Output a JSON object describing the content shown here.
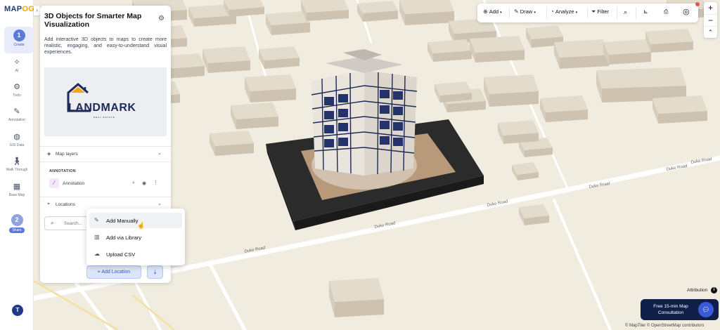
{
  "app": {
    "logo_main": "MAP",
    "logo_accent": "OG"
  },
  "rail": {
    "create": {
      "step": "1",
      "label": "Create"
    },
    "items": [
      {
        "label": "AI",
        "icon": "sparkle-icon"
      },
      {
        "label": "Tools",
        "icon": "tools-icon"
      },
      {
        "label": "Annotation",
        "icon": "annotation-icon"
      },
      {
        "label": "GIS Data",
        "icon": "database-icon"
      },
      {
        "label": "Walk Through",
        "icon": "walk-icon"
      },
      {
        "label": "Base Map",
        "icon": "basemap-icon"
      }
    ],
    "share": {
      "step": "2",
      "label": "Share"
    },
    "avatar": "T"
  },
  "panel": {
    "title": "3D Objects for Smarter Map Visualization",
    "description": "Add interactive 3D objects to maps to create more realistic, engaging, and easy-to-understand visual experiences.",
    "image": {
      "brand": "LANDMARK",
      "tagline": "REAL ESTATE"
    },
    "map_layers": "Map layers",
    "annotation_heading": "ANNOTATION",
    "annotation_item": "Annotation",
    "locations": "Locations",
    "search_placeholder": "Search...",
    "add_location": "Add Location"
  },
  "dropdown": {
    "items": [
      {
        "label": "Add Manually",
        "icon": "edit-icon"
      },
      {
        "label": "Add via Library",
        "icon": "library-icon"
      },
      {
        "label": "Upload CSV",
        "icon": "upload-cloud-icon"
      }
    ]
  },
  "toolbar": {
    "add": "Add",
    "draw": "Draw",
    "analyze": "Analyze",
    "filter": "Filter"
  },
  "zoom": {
    "in": "+",
    "out": "−"
  },
  "map": {
    "roads": [
      "Duke Road",
      "Duke Road",
      "Duke Road",
      "Duke Road",
      "Duke Road",
      "Duke Road"
    ]
  },
  "attribution": "Attribution",
  "consult": {
    "label": "Free 15-min Map Consultation"
  },
  "credits": "© MapTiler © OpenStreetMap contributors"
}
